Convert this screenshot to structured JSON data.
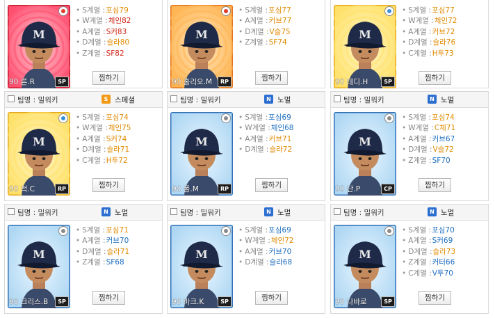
{
  "header_team_label": "팀명 : 밀워키",
  "favorite_button_label": "찜하기",
  "colors": {
    "value_orange": "#e08a00",
    "value_red": "#d12a1e",
    "value_blue": "#1f6fc0",
    "badge_normal": "#2b6ed0",
    "badge_special": "#f29a17"
  },
  "cards": [
    {
      "header": false,
      "name": "90 론.R",
      "position": "SP",
      "bg": "red",
      "stats": [
        {
          "label": "S계열 :",
          "value": "포심79",
          "color": "orange"
        },
        {
          "label": "W계열 :",
          "value": "체인82",
          "color": "red"
        },
        {
          "label": "A계열 :",
          "value": "S커83",
          "color": "red"
        },
        {
          "label": "D계열 :",
          "value": "슬라80",
          "color": "orange"
        },
        {
          "label": "Z계열 :",
          "value": "SF82",
          "color": "red"
        }
      ]
    },
    {
      "header": false,
      "name": "90 홀리오.M",
      "position": "RP",
      "bg": "orange",
      "stats": [
        {
          "label": "S계열 :",
          "value": "포심77",
          "color": "orange"
        },
        {
          "label": "A계열 :",
          "value": "커브77",
          "color": "orange"
        },
        {
          "label": "D계열 :",
          "value": "V슬75",
          "color": "orange"
        },
        {
          "label": "Z계열 :",
          "value": "SF74",
          "color": "orange"
        }
      ]
    },
    {
      "header": false,
      "name": "90 테디.H",
      "position": "SP",
      "bg": "yellow",
      "stats": [
        {
          "label": "S계열 :",
          "value": "포심77",
          "color": "orange"
        },
        {
          "label": "W계열 :",
          "value": "체인72",
          "color": "orange"
        },
        {
          "label": "A계열 :",
          "value": "커브72",
          "color": "orange"
        },
        {
          "label": "D계열 :",
          "value": "슬라76",
          "color": "orange"
        },
        {
          "label": "C계열 :",
          "value": "H투73",
          "color": "orange"
        }
      ]
    },
    {
      "header": true,
      "badge": "S",
      "type_name": "스페셜",
      "name": "90 척.C",
      "position": "RP",
      "bg": "yellow",
      "stats": [
        {
          "label": "S계열 :",
          "value": "포심74",
          "color": "orange"
        },
        {
          "label": "W계열 :",
          "value": "체인75",
          "color": "orange"
        },
        {
          "label": "A계열 :",
          "value": "S커74",
          "color": "orange"
        },
        {
          "label": "D계열 :",
          "value": "슬라71",
          "color": "orange"
        },
        {
          "label": "C계열 :",
          "value": "H투72",
          "color": "orange"
        }
      ]
    },
    {
      "header": true,
      "badge": "N",
      "type_name": "노멀",
      "name": "90 폴.M",
      "position": "RP",
      "bg": "blue",
      "stats": [
        {
          "label": "S계열 :",
          "value": "포심69",
          "color": "blue"
        },
        {
          "label": "W계열 :",
          "value": "체인68",
          "color": "blue"
        },
        {
          "label": "A계열 :",
          "value": "커브71",
          "color": "orange"
        },
        {
          "label": "D계열 :",
          "value": "슬라72",
          "color": "orange"
        }
      ]
    },
    {
      "header": true,
      "badge": "N",
      "type_name": "노멀",
      "name": "90 단.P",
      "position": "CP",
      "bg": "blue",
      "stats": [
        {
          "label": "S계열 :",
          "value": "포심74",
          "color": "orange"
        },
        {
          "label": "W계열 :",
          "value": "C체71",
          "color": "orange"
        },
        {
          "label": "A계열 :",
          "value": "커브67",
          "color": "blue"
        },
        {
          "label": "D계열 :",
          "value": "V슬72",
          "color": "orange"
        },
        {
          "label": "Z계열 :",
          "value": "SF70",
          "color": "blue"
        }
      ]
    },
    {
      "header": true,
      "badge": "N",
      "type_name": "노멀",
      "name": "90 크리스.B",
      "position": "SP",
      "bg": "blue",
      "stats": [
        {
          "label": "S계열 :",
          "value": "포심71",
          "color": "orange"
        },
        {
          "label": "A계열 :",
          "value": "커브70",
          "color": "blue"
        },
        {
          "label": "D계열 :",
          "value": "슬라71",
          "color": "orange"
        },
        {
          "label": "Z계열 :",
          "value": "SF68",
          "color": "blue"
        }
      ]
    },
    {
      "header": true,
      "badge": "N",
      "type_name": "노멀",
      "name": "90 마크.K",
      "position": "SP",
      "bg": "blue",
      "stats": [
        {
          "label": "S계열 :",
          "value": "포심69",
          "color": "blue"
        },
        {
          "label": "W계열 :",
          "value": "체인72",
          "color": "orange"
        },
        {
          "label": "A계열 :",
          "value": "커브70",
          "color": "blue"
        },
        {
          "label": "D계열 :",
          "value": "슬라68",
          "color": "blue"
        }
      ]
    },
    {
      "header": true,
      "badge": "N",
      "type_name": "노멀",
      "name": "90 나바로",
      "position": "SP",
      "bg": "blue",
      "stats": [
        {
          "label": "S계열 :",
          "value": "포심70",
          "color": "blue"
        },
        {
          "label": "A계열 :",
          "value": "S커69",
          "color": "blue"
        },
        {
          "label": "D계열 :",
          "value": "슬라73",
          "color": "orange"
        },
        {
          "label": "Z계열 :",
          "value": "커터66",
          "color": "blue"
        },
        {
          "label": "C계열 :",
          "value": "V투70",
          "color": "blue"
        }
      ]
    }
  ]
}
